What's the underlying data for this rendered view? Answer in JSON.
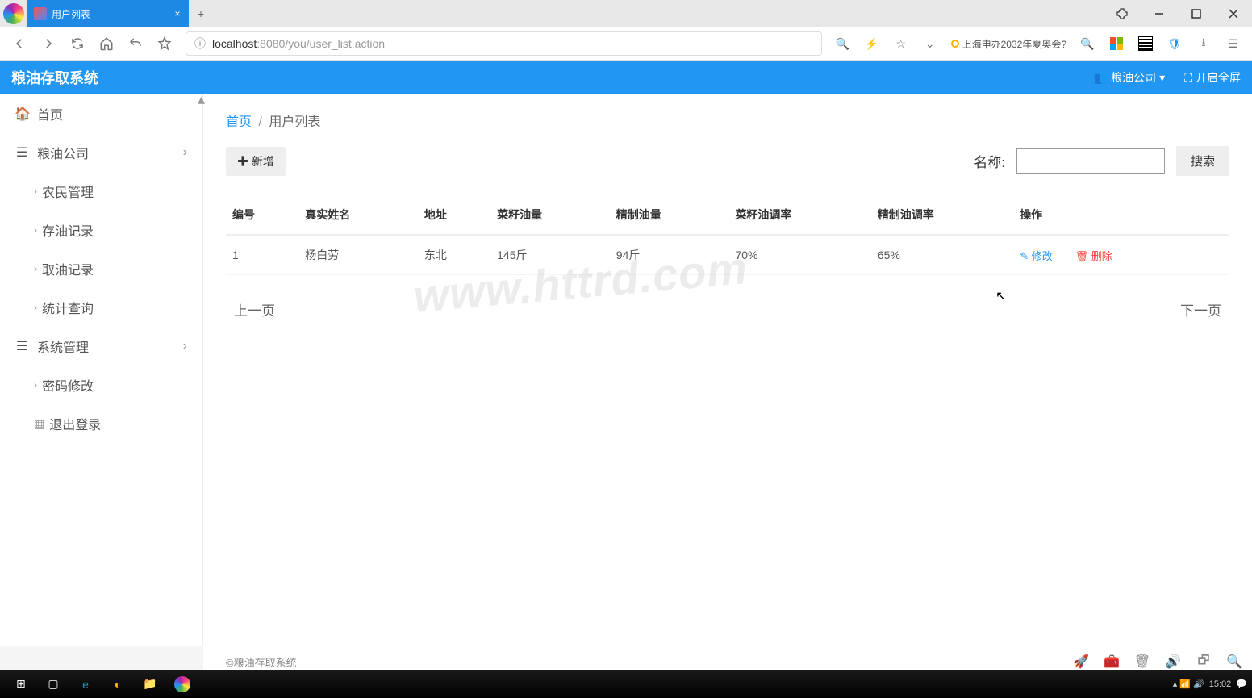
{
  "browser": {
    "tab_title": "用户列表",
    "url_host": "localhost",
    "url_port": ":8080",
    "url_path": "/you/user_list.action",
    "news_text": "上海申办2032年夏奥会?"
  },
  "app": {
    "title": "粮油存取系统",
    "header_user": "粮油公司",
    "header_fullscreen": "开启全屏"
  },
  "sidebar": {
    "home": "首页",
    "group1": "粮油公司",
    "g1_items": [
      "农民管理",
      "存油记录",
      "取油记录",
      "统计查询"
    ],
    "group2": "系统管理",
    "g2_items": [
      "密码修改",
      "退出登录"
    ]
  },
  "breadcrumb": {
    "home": "首页",
    "current": "用户列表"
  },
  "toolbar": {
    "add_label": "新增",
    "search_label": "名称:",
    "search_btn": "搜索"
  },
  "table": {
    "headers": [
      "编号",
      "真实姓名",
      "地址",
      "菜籽油量",
      "精制油量",
      "菜籽油调率",
      "精制油调率",
      "操作"
    ],
    "rows": [
      {
        "id": "1",
        "name": "杨白劳",
        "addr": "东北",
        "rape_oil": "145斤",
        "refined_oil": "94斤",
        "rape_rate": "70%",
        "refined_rate": "65%"
      }
    ],
    "edit_label": "修改",
    "del_label": "删除"
  },
  "pager": {
    "prev": "上一页",
    "next": "下一页"
  },
  "footer": "©粮油存取系统",
  "watermark": "www.httrd.com",
  "taskbar": {
    "time": "15:02"
  }
}
